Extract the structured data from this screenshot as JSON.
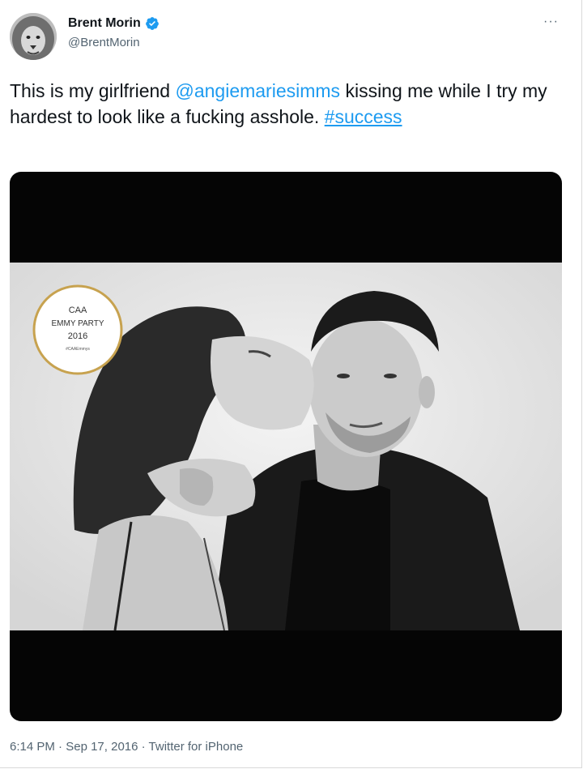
{
  "tweet": {
    "author": {
      "display_name": "Brent Morin",
      "handle": "@BrentMorin",
      "verified_icon": "verified-badge-icon",
      "avatar_icon": "lion-avatar"
    },
    "more_label": "···",
    "text": {
      "part1": "This is my girlfriend ",
      "mention": "@angiemariesimms",
      "part2": "  kissing me while I try my hardest to look like a fucking asshole. ",
      "hashtag": "#success"
    },
    "media": {
      "badge_lines": [
        "CAA",
        "EMMY PARTY",
        "2016",
        "#CAAEmmys"
      ]
    },
    "meta": {
      "time": "6:14 PM",
      "sep1": " · ",
      "date": "Sep 17, 2016",
      "sep2": " · ",
      "source": "Twitter for iPhone"
    }
  },
  "colors": {
    "link": "#1d9bf0",
    "secondary_text": "#536471",
    "badge_gold": "#c7a24f"
  }
}
